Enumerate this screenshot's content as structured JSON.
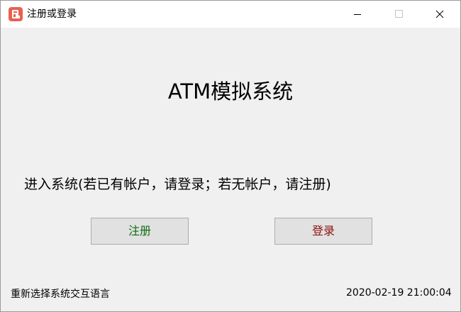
{
  "window": {
    "title": "注册或登录",
    "controls": {
      "minimize_icon": "minimize-icon",
      "maximize_icon": "maximize-icon",
      "close_icon": "close-icon"
    }
  },
  "main": {
    "heading": "ATM模拟系统",
    "prompt": "进入系统(若已有帐户，请登录；若无帐户，请注册)",
    "buttons": {
      "register_label": "注册",
      "login_label": "登录"
    }
  },
  "footer": {
    "language_link": "重新选择系统交互语言",
    "timestamp": "2020-02-19 21:00:04"
  },
  "colors": {
    "app_icon": "#e8614f",
    "register_text": "#0f6b0f",
    "login_text": "#8b1212",
    "window_background": "#f0f0f0",
    "titlebar_background": "#ffffff"
  }
}
